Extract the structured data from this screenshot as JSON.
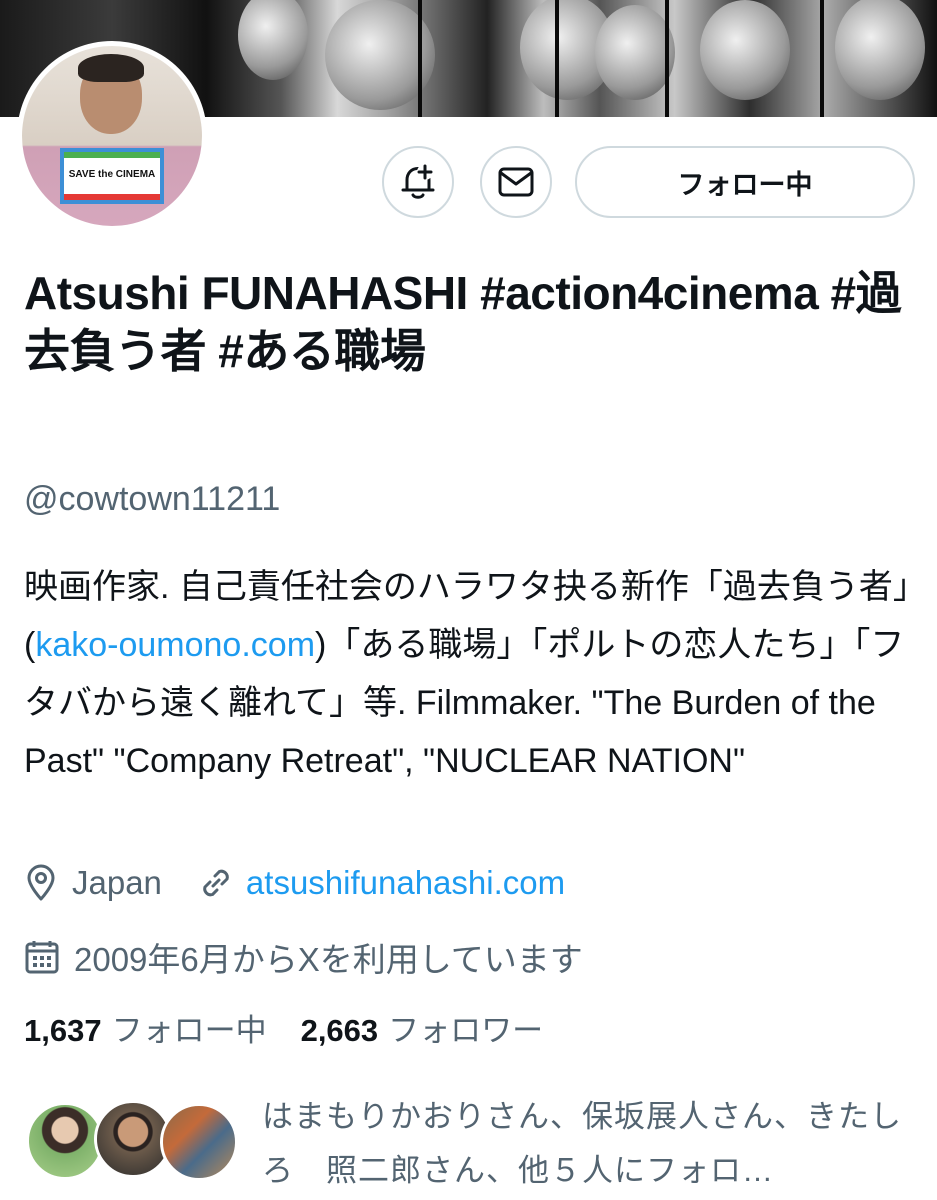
{
  "profile": {
    "name": "Atsushi FUNAHASHI #action4cinema #過去負う者 #ある職場",
    "handle": "@cowtown11211",
    "avatar_sign_text": "SAVE the CINEMA",
    "follow_button_label": "フォロー中",
    "bio_part1": "映画作家. 自己責任社会のハラワタ抉る新作「過去負う者」(",
    "bio_link": "kako-oumono.com",
    "bio_part2": ")「ある職場」「ポルトの恋人たち」「フタバから遠く離れて」等. Filmmaker. \"The Burden of the Past\" \"Company Retreat\", \"NUCLEAR NATION\"",
    "location": "Japan",
    "website": "atsushifunahashi.com",
    "joined": "2009年6月からXを利用しています",
    "following_count": "1,637",
    "following_label": "フォロー中",
    "followers_count": "2,663",
    "followers_label": "フォロワー",
    "followed_by_text": "はまもりかおりさん、保坂展人さん、きたしろ　照二郎さん、他５人にフォロ…"
  },
  "icons": {
    "notify": "bell-plus-icon",
    "message": "envelope-icon",
    "location": "location-pin-icon",
    "website": "link-icon",
    "joined": "calendar-icon"
  },
  "colors": {
    "link": "#1d9bf0",
    "secondary_text": "#536471",
    "border": "#cfd9de"
  }
}
